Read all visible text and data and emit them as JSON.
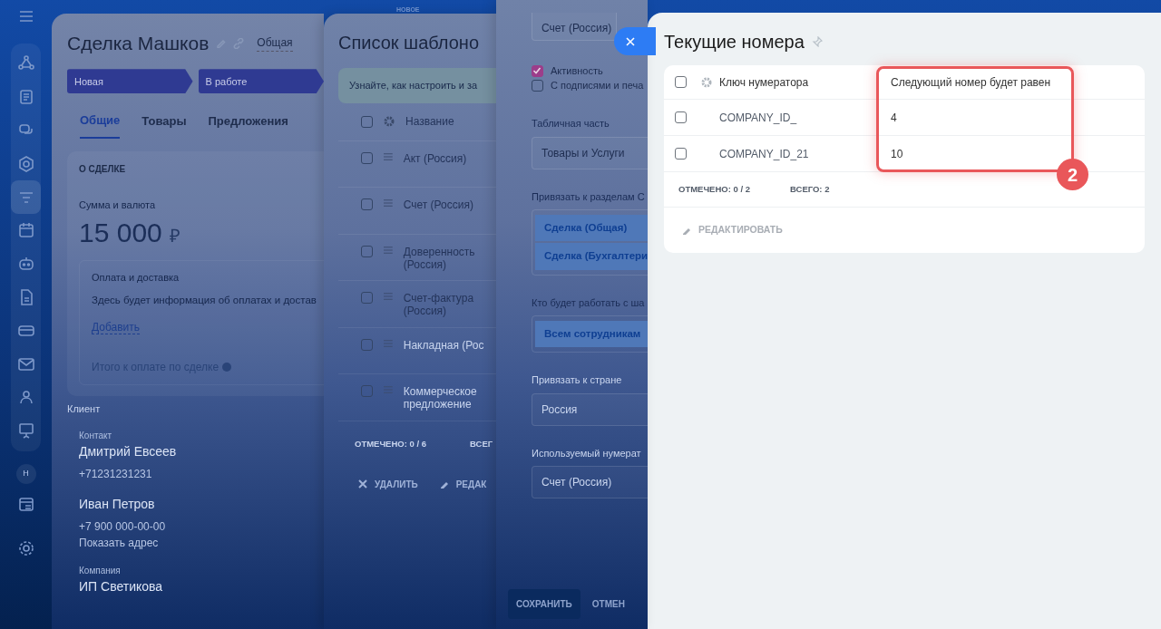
{
  "top_label": "НОВОЕ",
  "sidebar": {
    "avatar": "Н"
  },
  "deal": {
    "title": "Сделка Машков",
    "category": "Общая",
    "stages": [
      {
        "label": "Новая"
      },
      {
        "label": "В работе"
      }
    ],
    "tabs": [
      {
        "label": "Общие",
        "selected": true
      },
      {
        "label": "Товары",
        "selected": false
      },
      {
        "label": "Предложения",
        "selected": false
      }
    ],
    "section_title": "О СДЕЛКЕ",
    "amount_label": "Сумма и валюта",
    "amount": "15 000",
    "currency": "₽",
    "payment": {
      "title": "Оплата и доставка",
      "text": "Здесь будет информация об оплатах и достав",
      "link": "Добавить"
    },
    "total_label": "Итого к оплате по сделке",
    "client_label": "Клиент",
    "contacts": [
      {
        "label": "Контакт",
        "name": "Дмитрий Евсеев",
        "phone": "+71231231231"
      },
      {
        "name": "Иван Петров",
        "phone": "+7 900 000-00-00",
        "link": "Показать адрес"
      },
      {
        "label": "Компания",
        "name": "ИП Светикова"
      }
    ]
  },
  "templates": {
    "title": "Список шаблоно",
    "hint": "Узнайте, как настроить и за",
    "column": "Название",
    "all_checked": false,
    "rows": [
      {
        "name": "Акт (Россия)",
        "checked": false
      },
      {
        "name": "Счет (Россия)",
        "checked": false
      },
      {
        "name": "Доверенность (Россия)",
        "checked": false
      },
      {
        "name": "Счет-фактура (Россия)",
        "checked": false
      },
      {
        "name": "Накладная (Рос",
        "checked": false
      },
      {
        "name": "Коммерческое предложение",
        "checked": false
      }
    ],
    "checked_text": "ОТМЕЧЕНО: **0 / 6**",
    "total_text": "ВСЕГ",
    "actions": [
      {
        "kind": "delete",
        "label": "УДАЛИТЬ"
      },
      {
        "kind": "edit",
        "label": "РЕДАК"
      }
    ]
  },
  "settings": {
    "top_value": "Счет (Россия)",
    "checkboxes": [
      {
        "label": "Активность",
        "checked": true
      },
      {
        "label": "С подписями и печа",
        "checked": false
      }
    ],
    "fields": [
      {
        "kind": "select",
        "label": "Табличная часть",
        "value": "Товары и Услуги"
      },
      {
        "kind": "tags",
        "label": "Привязать к разделам С",
        "tags": [
          "Сделка (Общая)",
          "Сделка (Бухгалтери"
        ]
      },
      {
        "kind": "tags",
        "label": "Кто будет работать с ша",
        "tags": [
          "Всем сотрудникам"
        ]
      },
      {
        "kind": "select",
        "label": "Привязать к стране",
        "value": "Россия"
      },
      {
        "kind": "select",
        "label": "Используемый нумерат",
        "value": "Счет (Россия)"
      }
    ],
    "buttons": [
      "СОХРАНИТЬ",
      "ОТМЕН"
    ]
  },
  "numbers": {
    "title": "Текущие номера",
    "columns": [
      "Ключ нумератора",
      "Следующий номер будет равен"
    ],
    "all_checked": false,
    "rows": [
      {
        "key": "COMPANY_ID_",
        "next": "4",
        "checked": false
      },
      {
        "key": "COMPANY_ID_21",
        "next": "10",
        "checked": false
      }
    ],
    "checked_text": "ОТМЕЧЕНО: **0 / 2**",
    "total_text": "ВСЕГО: **2**",
    "action": "РЕДАКТИРОВАТЬ",
    "annotation": "2"
  }
}
